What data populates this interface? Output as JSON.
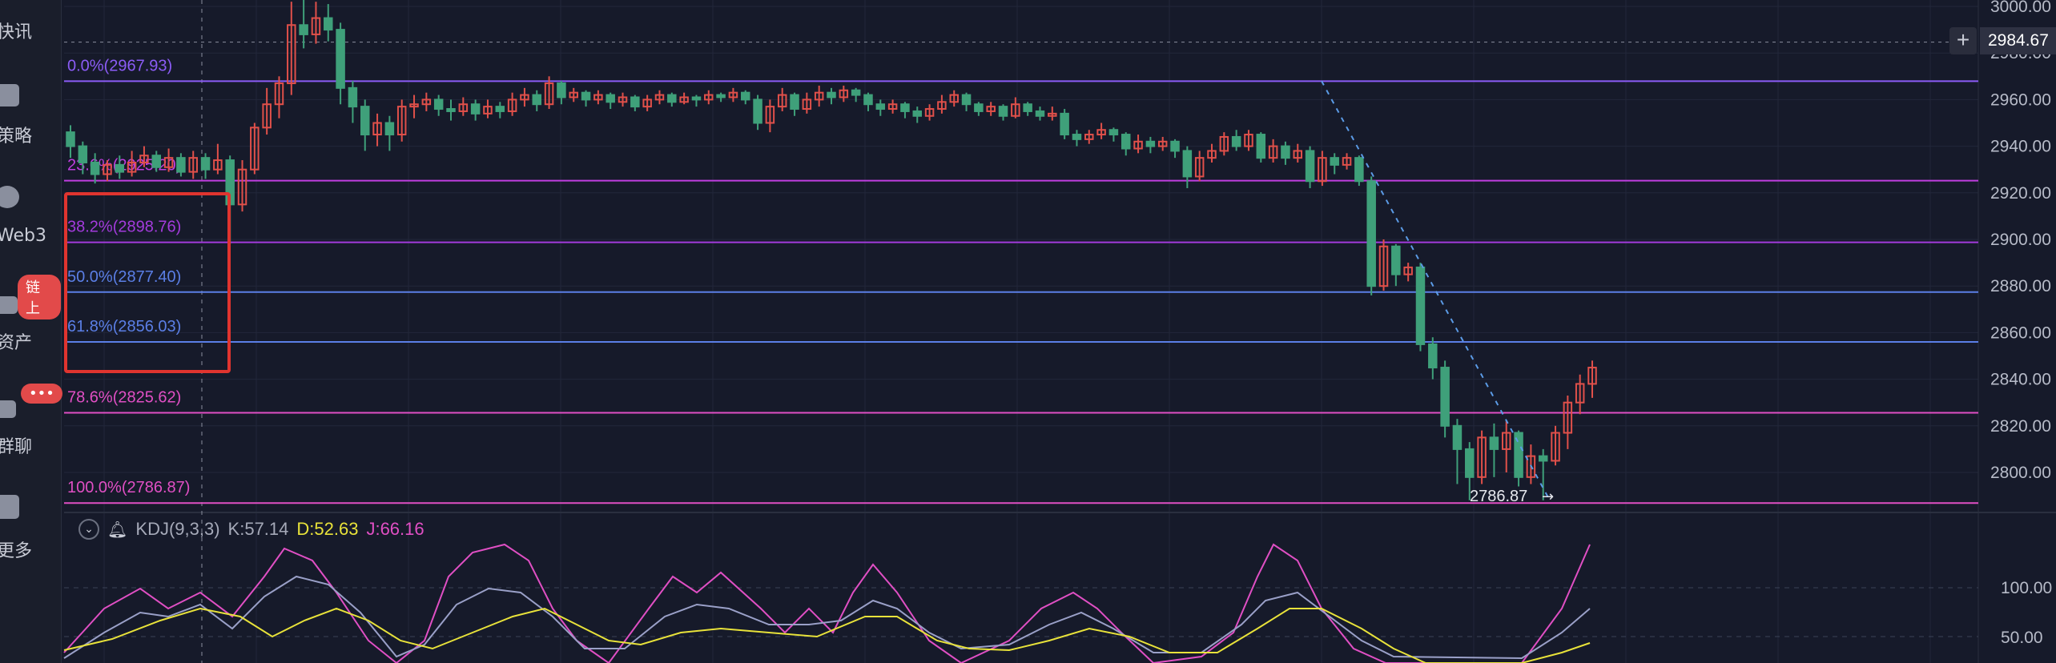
{
  "sidebar": {
    "items": [
      {
        "label": "快讯"
      },
      {
        "label": "策略"
      },
      {
        "label": "Web3"
      },
      {
        "label": "资产",
        "badge": "链上"
      },
      {
        "label": "群聊",
        "badge": "•••"
      },
      {
        "label": "更多"
      }
    ]
  },
  "price_axis": {
    "ticks": [
      "3000.00",
      "2980.00",
      "2960.00",
      "2940.00",
      "2920.00",
      "2900.00",
      "2880.00",
      "2860.00",
      "2840.00",
      "2820.00",
      "2800.00"
    ],
    "current_price": "2984.67"
  },
  "fib_levels": [
    {
      "label": "0.0%(2967.93)",
      "value": 2967.93,
      "color": "#8b5cf6"
    },
    {
      "label": "23.6%(2925.20)",
      "value": 2925.2,
      "color": "#c03ee0"
    },
    {
      "label": "38.2%(2898.76)",
      "value": 2898.76,
      "color": "#a33bdc"
    },
    {
      "label": "50.0%(2877.40)",
      "value": 2877.4,
      "color": "#5b7fe6"
    },
    {
      "label": "61.8%(2856.03)",
      "value": 2856.03,
      "color": "#5b7fe6"
    },
    {
      "label": "78.6%(2825.62)",
      "value": 2825.62,
      "color": "#e04fc4"
    },
    {
      "label": "100.0%(2786.87)",
      "value": 2786.87,
      "color": "#e04fc4"
    }
  ],
  "low_marker": {
    "label": "2786.87",
    "value": 2786.87
  },
  "indicator": {
    "name": "KDJ(9,3,3)",
    "k_label": "K:57.14",
    "d_label": "D:52.63",
    "j_label": "J:66.16",
    "axis_ticks": [
      "100.00",
      "50.00"
    ],
    "colors": {
      "k": "#9aa0c8",
      "d": "#e8e23a",
      "j": "#e04fc4"
    }
  },
  "chart_data": {
    "type": "candlestick",
    "ylim": [
      2780,
      3005
    ],
    "up_color": "#e0504a",
    "down_color": "#3fa07a",
    "candles": [
      [
        2946,
        2940,
        2949,
        2935
      ],
      [
        2940,
        2933,
        2942,
        2928
      ],
      [
        2933,
        2928,
        2937,
        2924
      ],
      [
        2928,
        2932,
        2934,
        2925
      ],
      [
        2932,
        2929,
        2936,
        2926
      ],
      [
        2929,
        2933,
        2938,
        2927
      ],
      [
        2933,
        2936,
        2940,
        2931
      ],
      [
        2936,
        2931,
        2938,
        2929
      ],
      [
        2931,
        2935,
        2939,
        2929
      ],
      [
        2935,
        2929,
        2937,
        2927
      ],
      [
        2929,
        2935,
        2938,
        2926
      ],
      [
        2935,
        2930,
        2937,
        2926
      ],
      [
        2930,
        2934,
        2941,
        2928
      ],
      [
        2934,
        2915,
        2936,
        2898
      ],
      [
        2915,
        2930,
        2934,
        2912
      ],
      [
        2930,
        2948,
        2950,
        2928
      ],
      [
        2948,
        2958,
        2965,
        2945
      ],
      [
        2958,
        2967,
        2970,
        2952
      ],
      [
        2967,
        2992,
        3002,
        2962
      ],
      [
        2992,
        2988,
        3003,
        2982
      ],
      [
        2988,
        2995,
        3002,
        2984
      ],
      [
        2995,
        2990,
        3001,
        2985
      ],
      [
        2990,
        2965,
        2993,
        2958
      ],
      [
        2965,
        2957,
        2968,
        2950
      ],
      [
        2957,
        2945,
        2960,
        2938
      ],
      [
        2945,
        2950,
        2954,
        2940
      ],
      [
        2950,
        2945,
        2953,
        2938
      ],
      [
        2945,
        2957,
        2960,
        2942
      ],
      [
        2957,
        2958,
        2962,
        2952
      ],
      [
        2958,
        2960,
        2963,
        2955
      ],
      [
        2960,
        2956,
        2962,
        2953
      ],
      [
        2956,
        2955,
        2960,
        2951
      ],
      [
        2955,
        2958,
        2961,
        2953
      ],
      [
        2958,
        2954,
        2960,
        2951
      ],
      [
        2954,
        2957,
        2960,
        2952
      ],
      [
        2957,
        2955,
        2959,
        2952
      ],
      [
        2955,
        2960,
        2963,
        2953
      ],
      [
        2960,
        2962,
        2965,
        2957
      ],
      [
        2962,
        2958,
        2964,
        2955
      ],
      [
        2958,
        2967,
        2970,
        2956
      ],
      [
        2967,
        2961,
        2968,
        2958
      ],
      [
        2961,
        2963,
        2965,
        2959
      ],
      [
        2963,
        2960,
        2964,
        2957
      ],
      [
        2960,
        2962,
        2964,
        2958
      ],
      [
        2962,
        2959,
        2963,
        2956
      ],
      [
        2959,
        2961,
        2963,
        2957
      ],
      [
        2961,
        2957,
        2962,
        2955
      ],
      [
        2957,
        2960,
        2962,
        2955
      ],
      [
        2960,
        2962,
        2964,
        2958
      ],
      [
        2962,
        2959,
        2963,
        2957
      ],
      [
        2959,
        2961,
        2963,
        2958
      ],
      [
        2961,
        2960,
        2962,
        2957
      ],
      [
        2960,
        2962,
        2964,
        2958
      ],
      [
        2962,
        2961,
        2963,
        2959
      ],
      [
        2961,
        2963,
        2965,
        2959
      ],
      [
        2963,
        2960,
        2964,
        2958
      ],
      [
        2960,
        2950,
        2962,
        2947
      ],
      [
        2950,
        2957,
        2960,
        2946
      ],
      [
        2957,
        2962,
        2965,
        2955
      ],
      [
        2962,
        2956,
        2963,
        2953
      ],
      [
        2956,
        2960,
        2963,
        2954
      ],
      [
        2960,
        2963,
        2966,
        2957
      ],
      [
        2963,
        2961,
        2965,
        2958
      ],
      [
        2961,
        2964,
        2966,
        2959
      ],
      [
        2964,
        2962,
        2965,
        2959
      ],
      [
        2962,
        2958,
        2963,
        2955
      ],
      [
        2958,
        2956,
        2960,
        2953
      ],
      [
        2956,
        2958,
        2960,
        2954
      ],
      [
        2958,
        2955,
        2959,
        2952
      ],
      [
        2955,
        2953,
        2957,
        2950
      ],
      [
        2953,
        2956,
        2958,
        2951
      ],
      [
        2956,
        2959,
        2962,
        2954
      ],
      [
        2959,
        2962,
        2964,
        2957
      ],
      [
        2962,
        2958,
        2963,
        2955
      ],
      [
        2958,
        2955,
        2959,
        2953
      ],
      [
        2955,
        2957,
        2959,
        2953
      ],
      [
        2957,
        2953,
        2958,
        2951
      ],
      [
        2953,
        2958,
        2961,
        2952
      ],
      [
        2958,
        2955,
        2959,
        2953
      ],
      [
        2955,
        2953,
        2957,
        2951
      ],
      [
        2953,
        2954,
        2957,
        2951
      ],
      [
        2954,
        2945,
        2956,
        2943
      ],
      [
        2945,
        2943,
        2947,
        2940
      ],
      [
        2943,
        2945,
        2947,
        2941
      ],
      [
        2945,
        2947,
        2950,
        2943
      ],
      [
        2947,
        2945,
        2948,
        2942
      ],
      [
        2945,
        2939,
        2946,
        2936
      ],
      [
        2939,
        2942,
        2945,
        2937
      ],
      [
        2942,
        2940,
        2944,
        2937
      ],
      [
        2940,
        2942,
        2944,
        2938
      ],
      [
        2942,
        2938,
        2943,
        2935
      ],
      [
        2938,
        2927,
        2940,
        2922
      ],
      [
        2927,
        2935,
        2938,
        2925
      ],
      [
        2935,
        2938,
        2941,
        2933
      ],
      [
        2938,
        2944,
        2946,
        2936
      ],
      [
        2944,
        2940,
        2947,
        2938
      ],
      [
        2940,
        2945,
        2947,
        2938
      ],
      [
        2945,
        2935,
        2946,
        2933
      ],
      [
        2935,
        2940,
        2943,
        2933
      ],
      [
        2940,
        2935,
        2942,
        2932
      ],
      [
        2935,
        2938,
        2941,
        2933
      ],
      [
        2938,
        2925,
        2940,
        2922
      ],
      [
        2925,
        2935,
        2938,
        2923
      ],
      [
        2935,
        2932,
        2937,
        2928
      ],
      [
        2932,
        2935,
        2937,
        2930
      ],
      [
        2935,
        2925,
        2936,
        2923
      ],
      [
        2925,
        2880,
        2927,
        2876
      ],
      [
        2880,
        2897,
        2900,
        2878
      ],
      [
        2897,
        2885,
        2898,
        2880
      ],
      [
        2885,
        2888,
        2890,
        2882
      ],
      [
        2888,
        2855,
        2890,
        2852
      ],
      [
        2855,
        2845,
        2858,
        2840
      ],
      [
        2845,
        2820,
        2848,
        2815
      ],
      [
        2820,
        2810,
        2823,
        2795
      ],
      [
        2810,
        2798,
        2813,
        2788
      ],
      [
        2798,
        2815,
        2818,
        2795
      ],
      [
        2815,
        2810,
        2821,
        2798
      ],
      [
        2810,
        2817,
        2822,
        2800
      ],
      [
        2817,
        2798,
        2818,
        2794
      ],
      [
        2798,
        2807,
        2812,
        2795
      ],
      [
        2807,
        2805,
        2810,
        2788
      ],
      [
        2805,
        2817,
        2820,
        2803
      ],
      [
        2817,
        2830,
        2833,
        2810
      ],
      [
        2830,
        2838,
        2842,
        2825
      ],
      [
        2838,
        2845,
        2848,
        2832
      ]
    ]
  }
}
